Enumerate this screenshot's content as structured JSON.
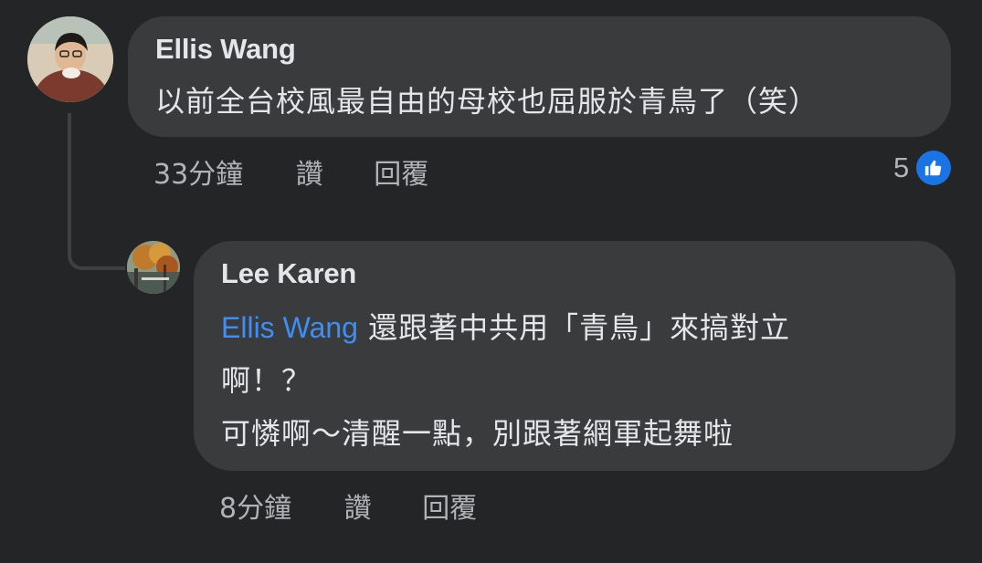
{
  "comment": {
    "author": "Ellis Wang",
    "text": "以前全台校風最自由的母校也屈服於青鳥了（笑）",
    "time": "33分鐘",
    "like_label": "讚",
    "reply_label": "回覆",
    "reaction_count": "5",
    "reaction_icon": "like-icon",
    "colors": {
      "bubble": "#3a3b3c",
      "background": "#242526",
      "like": "#1b74e4"
    }
  },
  "reply": {
    "author": "Lee Karen",
    "mention": "Ellis Wang",
    "lines": [
      "還跟著中共用「青鳥」來搞對立",
      "啊！？",
      "可憐啊～清醒一點，別跟著網軍起舞啦"
    ],
    "time": "8分鐘",
    "like_label": "讚",
    "reply_label": "回覆",
    "colors": {
      "mention": "#3e8ef7"
    }
  }
}
